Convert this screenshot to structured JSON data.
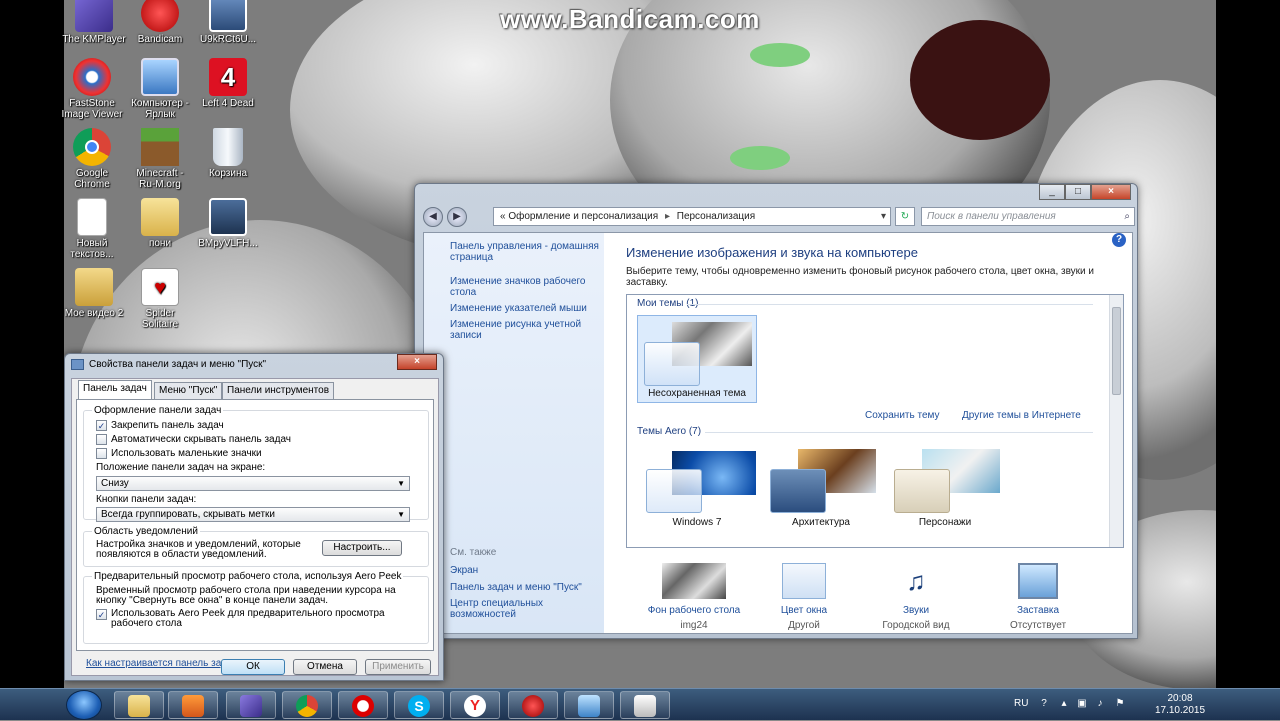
{
  "watermark": "www.Bandicam.com",
  "desktop_icons": [
    {
      "label": "The KMPlayer",
      "icon": "kmplayer-icon"
    },
    {
      "label": "Bandicam",
      "icon": "bandicam-icon"
    },
    {
      "label": "U9kRCt6U...",
      "icon": "image-file-icon"
    },
    {
      "label": "FastStone Image Viewer",
      "icon": "faststone-icon"
    },
    {
      "label": "Компьютер - Ярлык",
      "icon": "computer-icon"
    },
    {
      "label": "Left 4 Dead",
      "icon": "left4dead-icon"
    },
    {
      "label": "Google Chrome",
      "icon": "chrome-icon"
    },
    {
      "label": "Minecraft - Ru-M.org",
      "icon": "minecraft-icon"
    },
    {
      "label": "Корзина",
      "icon": "recycle-bin-icon"
    },
    {
      "label": "Новый текстов...",
      "icon": "text-file-icon"
    },
    {
      "label": "пони",
      "icon": "folder-icon"
    },
    {
      "label": "BMpyVLFH...",
      "icon": "image-file-icon"
    },
    {
      "label": "Мое видео 2",
      "icon": "folder-icon"
    },
    {
      "label": "Spider Solitaire",
      "icon": "spider-solitaire-icon"
    }
  ],
  "control_panel": {
    "breadcrumb": [
      "Оформление и персонализация",
      "Персонализация"
    ],
    "search_placeholder": "Поиск в панели управления",
    "left_links": [
      "Панель управления - домашняя страница",
      "Изменение значков рабочего стола",
      "Изменение указателей мыши",
      "Изменение рисунка учетной записи"
    ],
    "see_also_header": "См. также",
    "see_also_links": [
      "Экран",
      "Панель задач и меню \"Пуск\"",
      "Центр специальных возможностей"
    ],
    "title": "Изменение изображения и звука на компьютере",
    "subtitle": "Выберите тему, чтобы одновременно изменить фоновый рисунок рабочего стола, цвет окна, звуки и заставку.",
    "my_themes_header": "Мои темы (1)",
    "my_themes": [
      {
        "name": "Несохраненная тема"
      }
    ],
    "save_theme": "Сохранить тему",
    "more_themes": "Другие темы в Интернете",
    "aero_header": "Темы Aero (7)",
    "aero_themes": [
      {
        "name": "Windows 7"
      },
      {
        "name": "Архитектура"
      },
      {
        "name": "Персонажи"
      }
    ],
    "bottom_items": [
      {
        "title": "Фон рабочего стола",
        "sub": "img24",
        "icon": "wallpaper-icon"
      },
      {
        "title": "Цвет окна",
        "sub": "Другой",
        "icon": "window-color-icon"
      },
      {
        "title": "Звуки",
        "sub": "Городской вид",
        "icon": "sounds-icon"
      },
      {
        "title": "Заставка",
        "sub": "Отсутствует",
        "icon": "screensaver-icon"
      }
    ]
  },
  "taskbar_dialog": {
    "title": "Свойства панели задач и меню \"Пуск\"",
    "tabs": [
      "Панель задач",
      "Меню \"Пуск\"",
      "Панели инструментов"
    ],
    "group_appearance": "Оформление панели задач",
    "chk_lock": "Закрепить панель задач",
    "chk_autohide": "Автоматически скрывать панель задач",
    "chk_small": "Использовать маленькие значки",
    "position_label": "Положение панели задач на экране:",
    "position_value": "Снизу",
    "buttons_label": "Кнопки панели задач:",
    "buttons_value": "Всегда группировать, скрывать метки",
    "group_notify": "Область уведомлений",
    "notify_text": "Настройка значков и уведомлений, которые появляются в области уведомлений.",
    "customize_btn": "Настроить...",
    "group_peek": "Предварительный просмотр рабочего стола, используя Aero Peek",
    "peek_text": "Временный просмотр рабочего стола при наведении курсора на кнопку \"Свернуть все окна\" в конце панели задач.",
    "chk_peek": "Использовать Aero Peek для предварительного просмотра рабочего стола",
    "help_link": "Как настраивается панель задач?",
    "ok": "ОК",
    "cancel": "Отмена",
    "apply": "Применить",
    "checked": {
      "lock": true,
      "autohide": false,
      "small": false,
      "peek": true
    }
  },
  "tray": {
    "lang": "RU",
    "time": "20:08",
    "date": "17.10.2015"
  }
}
